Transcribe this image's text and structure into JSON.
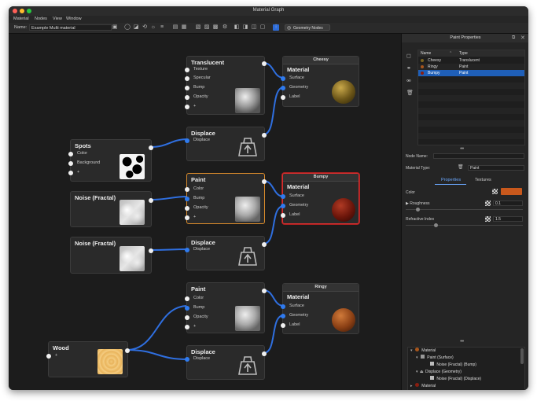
{
  "window": {
    "title": "Material Graph"
  },
  "menu": [
    "Material",
    "Nodes",
    "View",
    "Window"
  ],
  "toolbar": {
    "name_label": "Name:",
    "name_value": "Example Multi material",
    "geometry_nodes": "Geometry Nodes"
  },
  "nodes": {
    "translucent": {
      "title": "Translucent",
      "ports": [
        "Texture",
        "Specular",
        "Bump",
        "Opacity",
        "+"
      ]
    },
    "cheesy": {
      "caption": "Cheesy",
      "title": "Material",
      "ports": [
        "Surface",
        "Geometry",
        "Label"
      ]
    },
    "displace1": {
      "title": "Displace",
      "ports": [
        "Displace"
      ]
    },
    "spots": {
      "title": "Spots",
      "ports": [
        "Color",
        "Background",
        "+"
      ]
    },
    "paint1": {
      "title": "Paint",
      "ports": [
        "Color",
        "Bump",
        "Opacity",
        "+"
      ]
    },
    "bumpy": {
      "caption": "Bumpy",
      "title": "Material",
      "ports": [
        "Surface",
        "Geometry",
        "Label"
      ]
    },
    "noise1": {
      "title": "Noise (Fractal)"
    },
    "displace2": {
      "title": "Displace",
      "ports": [
        "Displace"
      ]
    },
    "noise2": {
      "title": "Noise (Fractal)"
    },
    "paint2": {
      "title": "Paint",
      "ports": [
        "Color",
        "Bump",
        "Opacity",
        "+"
      ]
    },
    "ringy": {
      "caption": "Ringy",
      "title": "Material",
      "ports": [
        "Surface",
        "Geometry",
        "Label"
      ]
    },
    "wood": {
      "title": "Wood",
      "ports": [
        "+"
      ]
    },
    "displace3": {
      "title": "Displace",
      "ports": [
        "Displace"
      ]
    }
  },
  "panel": {
    "title": "Paint Properties",
    "table": {
      "headers": [
        "Name",
        "Type"
      ],
      "rows": [
        {
          "name": "Cheesy",
          "type": "Translucent",
          "swatch": "#7a6420"
        },
        {
          "name": "Ringy",
          "type": "Paint",
          "swatch": "#a8561c"
        },
        {
          "name": "Bumpy",
          "type": "Paint",
          "swatch": "#8a1e10"
        }
      ]
    },
    "node_name_label": "Node Name:",
    "node_name_value": "",
    "material_type_label": "Material Type:",
    "material_type_value": "Paint",
    "tabs": [
      "Properties",
      "Textures"
    ],
    "color_label": "Color",
    "color_value": "#c8581c",
    "roughness_label": "Roughness",
    "roughness_value": "0.1",
    "refractive_label": "Refractive Index",
    "refractive_value": "1.5",
    "tree": [
      "Material",
      "Paint (Surface)",
      "Noise (Fractal) (Bump)",
      "Displace (Geometry)",
      "Noise (Fractal) (Displace)",
      "Material"
    ]
  },
  "colors": {
    "accent": "#2f7bef",
    "wire": "#2f6fe0",
    "selected_orange": "#d98b2b",
    "selected_red": "#d93030"
  }
}
